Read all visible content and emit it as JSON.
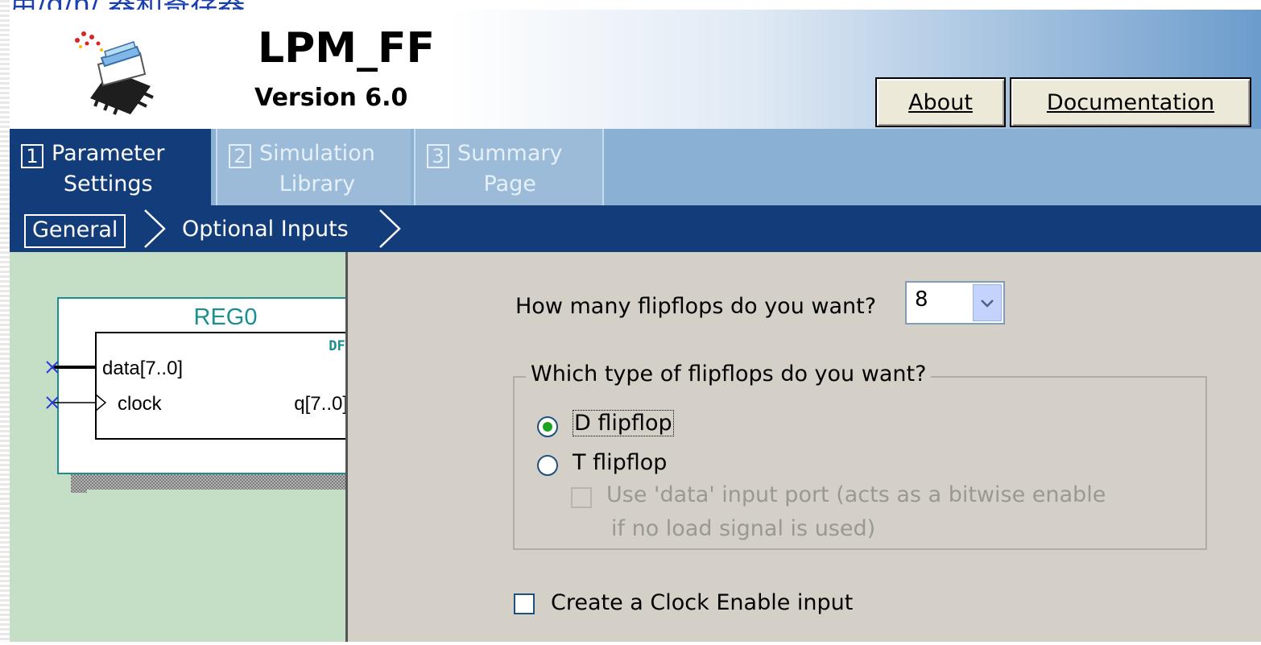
{
  "caption": "用/d/n/ 器和寄存器",
  "header": {
    "title": "LPM_FF",
    "version": "Version 6.0",
    "about_label": "About",
    "documentation_label": "Documentation"
  },
  "tabs": [
    {
      "number": "1",
      "line1": "Parameter",
      "line2": "Settings",
      "active": true
    },
    {
      "number": "2",
      "line1": "Simulation",
      "line2": "Library",
      "active": false
    },
    {
      "number": "3",
      "line1": "Summary",
      "line2": "Page",
      "active": false
    }
  ],
  "subnav": {
    "general": "General",
    "optional_inputs": "Optional Inputs"
  },
  "preview": {
    "instance_name": "REG0",
    "type_label": "DFF",
    "port_data": "data[7..0]",
    "port_clock": "clock",
    "port_q": "q[7..0]"
  },
  "form": {
    "flipflop_count_question": "How many flipflops do you want?",
    "flipflop_count_value": "8",
    "flipflop_type_question": "Which type of flipflops do you want?",
    "option_d": "D flipflop",
    "option_t": "T flipflop",
    "selected_type": "D flipflop",
    "use_data_line1": "Use 'data' input port (acts as a bitwise enable",
    "use_data_line2": "if no load signal is used)",
    "clock_enable_label": "Create a Clock Enable input"
  },
  "colors": {
    "header_dark": "#123d7a",
    "tab_inactive": "#9bbbd9",
    "preview_bg": "#c5dfc7",
    "dialog_bg": "#d4d0c8",
    "symbol_teal": "#1b8e8e"
  }
}
